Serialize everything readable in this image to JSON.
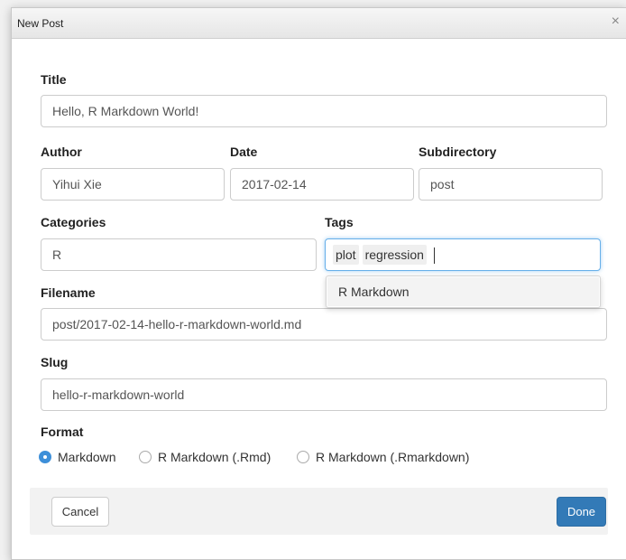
{
  "window": {
    "title": "New Post",
    "close_glyph": "×"
  },
  "form": {
    "title": {
      "label": "Title",
      "value": "Hello, R Markdown World!"
    },
    "author": {
      "label": "Author",
      "value": "Yihui Xie"
    },
    "date": {
      "label": "Date",
      "value": "2017-02-14"
    },
    "subdirectory": {
      "label": "Subdirectory",
      "value": "post"
    },
    "categories": {
      "label": "Categories",
      "value": "R"
    },
    "tags": {
      "label": "Tags",
      "chips": [
        "plot",
        "regression"
      ],
      "suggestion": "R Markdown"
    },
    "filename": {
      "label": "Filename",
      "value": "post/2017-02-14-hello-r-markdown-world.md"
    },
    "slug": {
      "label": "Slug",
      "value": "hello-r-markdown-world"
    },
    "format": {
      "label": "Format",
      "options": [
        "Markdown",
        "R Markdown (.Rmd)",
        "R Markdown (.Rmarkdown)"
      ],
      "selected": "Markdown"
    }
  },
  "buttons": {
    "cancel": "Cancel",
    "done": "Done"
  },
  "colors": {
    "primary": "#337ab7",
    "radio_checked": "#3d8fd9",
    "focus_border": "#66afe9"
  }
}
